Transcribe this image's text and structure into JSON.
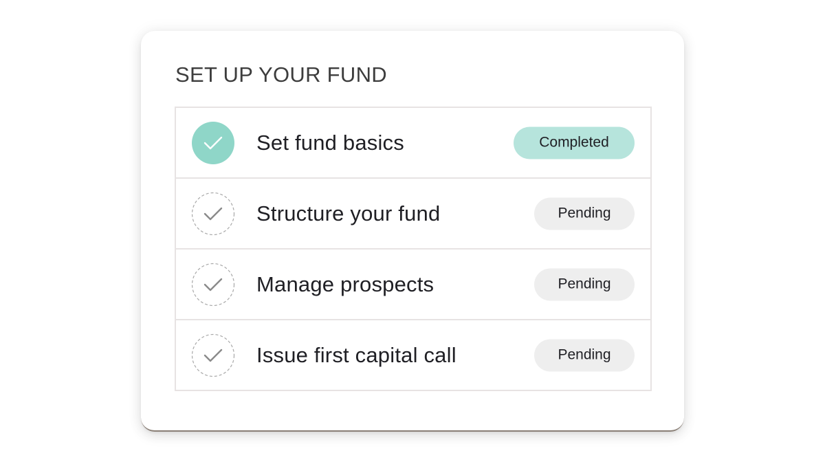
{
  "card": {
    "title": "SET UP YOUR FUND"
  },
  "tasks": [
    {
      "label": "Set fund basics",
      "status": "Completed",
      "done": true,
      "icon": "check-circle-filled-icon"
    },
    {
      "label": "Structure your fund",
      "status": "Pending",
      "done": false,
      "icon": "check-circle-dashed-icon"
    },
    {
      "label": "Manage prospects",
      "status": "Pending",
      "done": false,
      "icon": "check-circle-dashed-icon"
    },
    {
      "label": "Issue first capital call",
      "status": "Pending",
      "done": false,
      "icon": "check-circle-dashed-icon"
    }
  ],
  "colors": {
    "accent": "#8fd6c8",
    "completed_badge": "#b6e4dc",
    "pending_badge": "#eeeeee",
    "row_border": "#e7e3e3"
  }
}
